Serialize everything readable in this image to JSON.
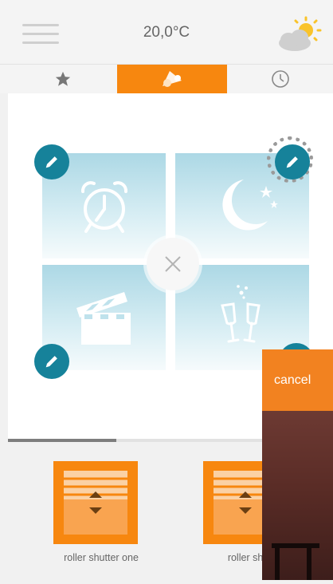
{
  "header": {
    "temperature": "20,0°C",
    "weather_icon": "partly-sunny-icon",
    "menu_icon": "hamburger-menu-icon"
  },
  "tabs": [
    {
      "name": "favorites",
      "icon": "star-icon",
      "active": false
    },
    {
      "name": "scenes",
      "icon": "scenes-icon",
      "active": true
    },
    {
      "name": "timer",
      "icon": "clock-icon",
      "active": false
    }
  ],
  "scenes": [
    {
      "icon": "alarm-clock-icon"
    },
    {
      "icon": "moon-stars-icon"
    },
    {
      "icon": "clapperboard-icon"
    },
    {
      "icon": "champagne-glasses-icon"
    }
  ],
  "center_control": {
    "icon": "close-icon"
  },
  "edit_icon": "pencil-icon",
  "devices": [
    {
      "label": "roller shutter one",
      "icon": "roller-shutter-icon"
    },
    {
      "label": "roller shutt",
      "icon": "roller-shutter-icon"
    }
  ],
  "overlay": {
    "cancel_label": "cancel"
  },
  "colors": {
    "accent": "#f7870f",
    "edit_button": "#16829a",
    "tile_top": "#acd8e5",
    "background": "#f1f1f1"
  }
}
